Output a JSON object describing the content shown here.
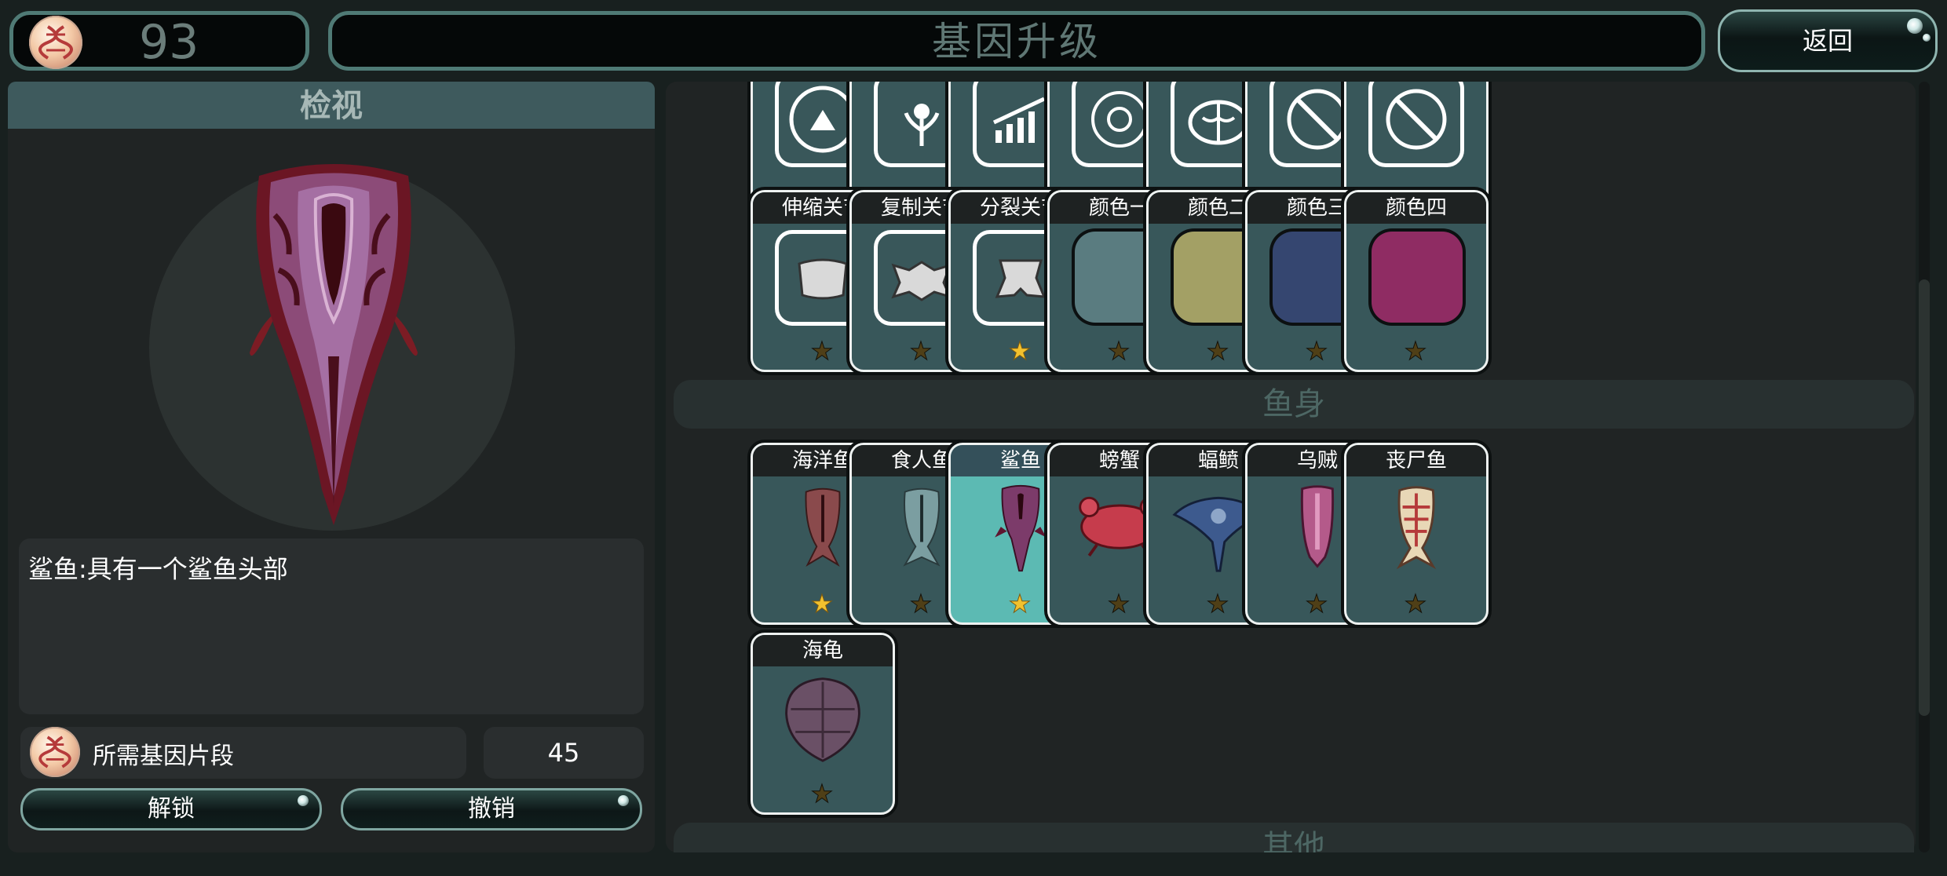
{
  "top_bar": {
    "currency_value": "93",
    "title": "基因升级",
    "back_label": "返回"
  },
  "inspect": {
    "header": "检视",
    "description": "鲨鱼:具有一个鲨鱼头部",
    "required_label": "所需基因片段",
    "required_count": "45",
    "unlock_label": "解锁",
    "cancel_label": "撤销"
  },
  "top_partial_row": [
    {
      "icon": "mountain-icon",
      "stars": [
        0,
        0,
        0,
        0
      ]
    },
    {
      "icon": "flower-icon",
      "stars": [
        0,
        0,
        0,
        0
      ]
    },
    {
      "icon": "growth-bars-icon",
      "stars": [
        0,
        0,
        0,
        0
      ]
    },
    {
      "icon": "gear-sun-icon",
      "stars": [
        0,
        0,
        0,
        0
      ]
    },
    {
      "icon": "brain-icon",
      "stars": [
        0
      ]
    },
    {
      "icon": "no-bite-icon",
      "stars": [
        1
      ]
    },
    {
      "icon": "no-bite-icon",
      "stars": [
        1,
        0,
        0
      ]
    }
  ],
  "joint_row": [
    {
      "title": "伸缩关节",
      "icon": "joint-telescopic-icon",
      "stars": [
        0
      ]
    },
    {
      "title": "复制关节",
      "icon": "joint-copy-icon",
      "stars": [
        0
      ]
    },
    {
      "title": "分裂关节",
      "icon": "joint-split-icon",
      "stars": [
        1
      ]
    },
    {
      "title": "颜色一",
      "icon": "color-swatch-icon",
      "color": "#5a7c80",
      "stars": [
        0
      ]
    },
    {
      "title": "颜色二",
      "icon": "color-swatch-icon",
      "color": "#a3a065",
      "stars": [
        0
      ]
    },
    {
      "title": "颜色三",
      "icon": "color-swatch-icon",
      "color": "#354670",
      "stars": [
        0
      ]
    },
    {
      "title": "颜色四",
      "icon": "color-swatch-icon",
      "color": "#8f2c63",
      "stars": [
        0
      ]
    }
  ],
  "sections": {
    "body": "鱼身",
    "other": "其他"
  },
  "body_row1": [
    {
      "title": "海洋鱼",
      "icon": "ocean-fish-icon",
      "stars": [
        1
      ],
      "selected": false
    },
    {
      "title": "食人鱼",
      "icon": "piranha-icon",
      "stars": [
        0
      ],
      "selected": false
    },
    {
      "title": "鲨鱼",
      "icon": "shark-icon",
      "stars": [
        1
      ],
      "selected": true
    },
    {
      "title": "螃蟹",
      "icon": "crab-icon",
      "stars": [
        0
      ],
      "selected": false
    },
    {
      "title": "蝠鲼",
      "icon": "manta-ray-icon",
      "stars": [
        0
      ],
      "selected": false
    },
    {
      "title": "乌贼",
      "icon": "squid-icon",
      "stars": [
        0
      ],
      "selected": false
    },
    {
      "title": "丧尸鱼",
      "icon": "zombie-fish-icon",
      "stars": [
        0
      ],
      "selected": false
    }
  ],
  "body_row2": [
    {
      "title": "海龟",
      "icon": "turtle-icon",
      "stars": [
        0
      ],
      "selected": false
    }
  ],
  "colors": {
    "accent_teal": "#5cbab3",
    "card_bg": "#38575a",
    "star_on": "#f2c12e",
    "star_off": "#4f3f17"
  }
}
